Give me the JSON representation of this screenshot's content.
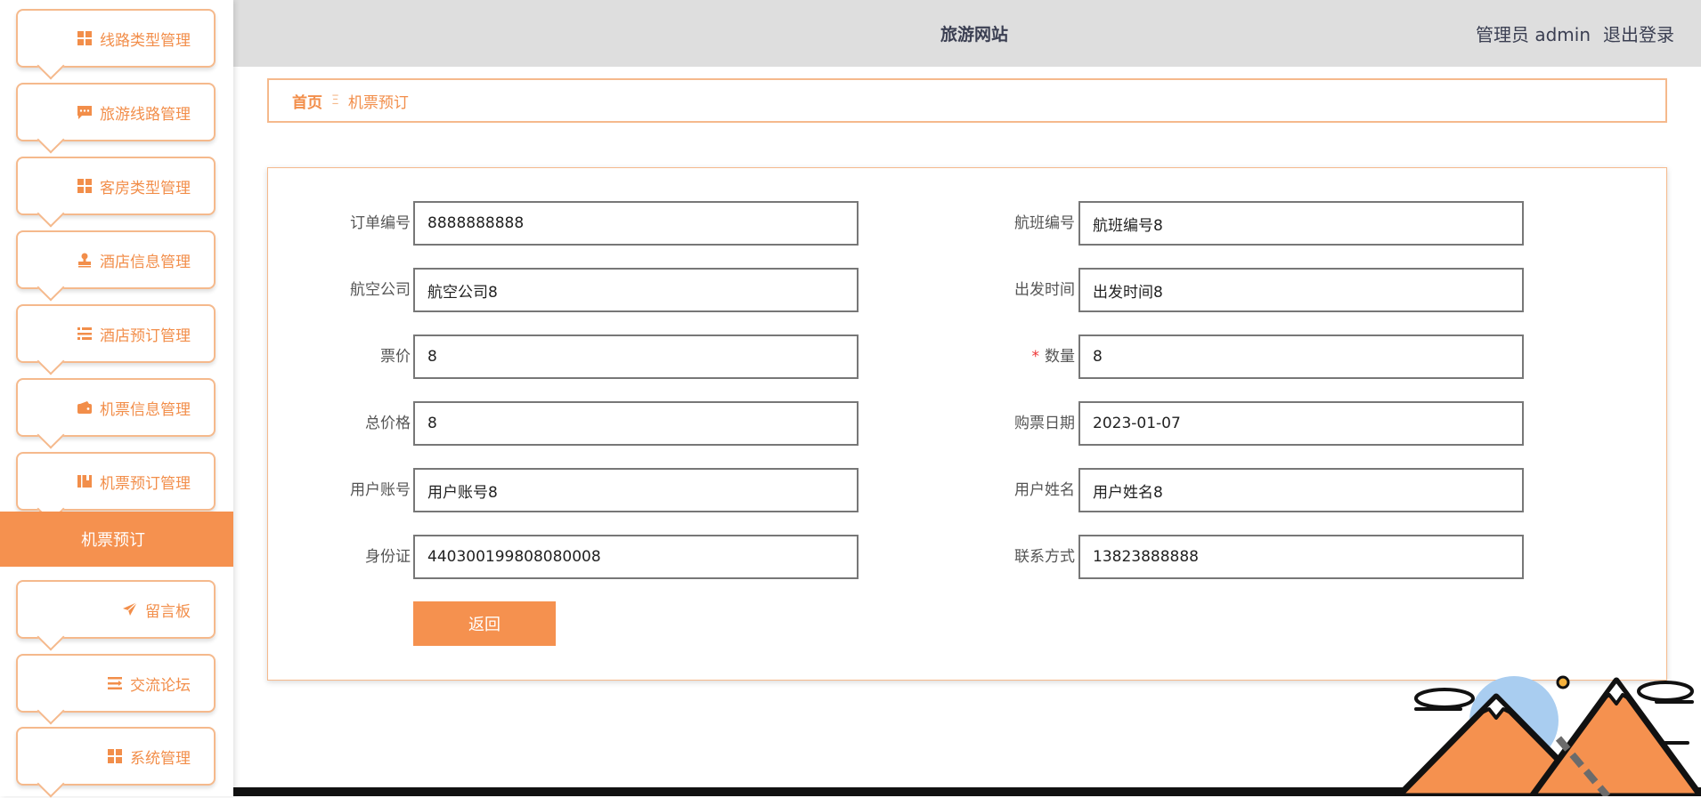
{
  "header": {
    "site_title": "旅游网站",
    "role": "管理员",
    "username": "admin",
    "logout": "退出登录"
  },
  "sidebar": {
    "items": [
      {
        "label": "线路类型管理",
        "icon": "grid-icon"
      },
      {
        "label": "旅游线路管理",
        "icon": "chat-icon"
      },
      {
        "label": "客房类型管理",
        "icon": "grid-icon"
      },
      {
        "label": "酒店信息管理",
        "icon": "stamp-icon"
      },
      {
        "label": "酒店预订管理",
        "icon": "list-icon"
      },
      {
        "label": "机票信息管理",
        "icon": "wallet-icon"
      },
      {
        "label": "机票预订管理",
        "icon": "book-icon"
      }
    ],
    "active": {
      "label": "机票预订"
    },
    "items_after": [
      {
        "label": "留言板",
        "icon": "send-icon"
      },
      {
        "label": "交流论坛",
        "icon": "list-icon"
      },
      {
        "label": "系统管理",
        "icon": "grid-icon"
      }
    ]
  },
  "breadcrumb": {
    "home": "首页",
    "separator": "Ξ",
    "current": "机票预订"
  },
  "form": {
    "order_no": {
      "label": "订单编号",
      "value": "8888888888"
    },
    "flight_no": {
      "label": "航班编号",
      "value": "航班编号8"
    },
    "airline": {
      "label": "航空公司",
      "value": "航空公司8"
    },
    "departure_time": {
      "label": "出发时间",
      "value": "出发时间8"
    },
    "price": {
      "label": "票价",
      "value": "8"
    },
    "quantity": {
      "label": "数量",
      "value": "8",
      "required_mark": "*"
    },
    "total_price": {
      "label": "总价格",
      "value": "8"
    },
    "purchase_date": {
      "label": "购票日期",
      "value": "2023-01-07"
    },
    "user_account": {
      "label": "用户账号",
      "value": "用户账号8"
    },
    "user_name": {
      "label": "用户姓名",
      "value": "用户姓名8"
    },
    "id_card": {
      "label": "身份证",
      "value": "440300199808080008"
    },
    "contact": {
      "label": "联系方式",
      "value": "13823888888"
    },
    "back_button": "返回"
  },
  "colors": {
    "accent": "#f5914f",
    "accent_light": "#f5b98c",
    "header_bg": "#dedede",
    "title_text": "#3b3f52"
  }
}
